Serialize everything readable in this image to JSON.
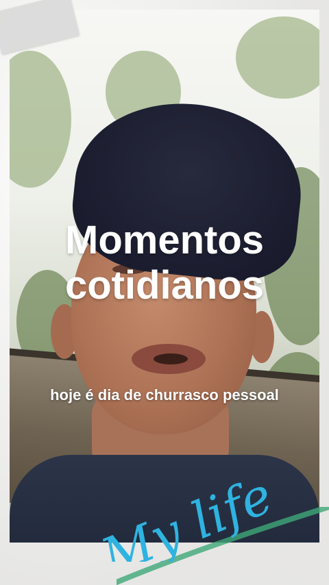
{
  "overlay": {
    "title": "Momentos\ncotidianos",
    "caption": "hoje é dia de churrasco pessoal",
    "script_text": "My life"
  },
  "colors": {
    "frame": "#ecebea",
    "script": "#2fb3e0",
    "stroke": "#3fa878",
    "title_text": "#ffffff"
  }
}
